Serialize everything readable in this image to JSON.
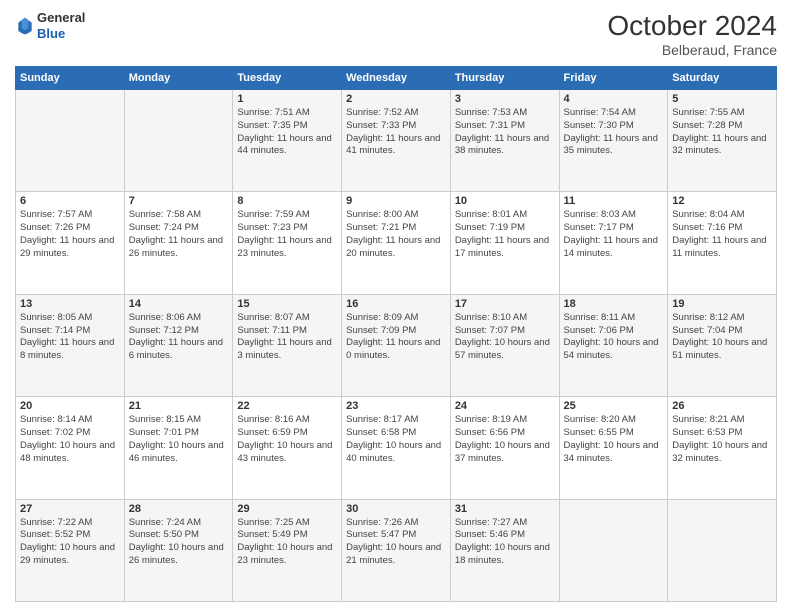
{
  "header": {
    "logo_general": "General",
    "logo_blue": "Blue",
    "month_year": "October 2024",
    "location": "Belberaud, France"
  },
  "days_of_week": [
    "Sunday",
    "Monday",
    "Tuesday",
    "Wednesday",
    "Thursday",
    "Friday",
    "Saturday"
  ],
  "weeks": [
    [
      {
        "day": "",
        "info": ""
      },
      {
        "day": "",
        "info": ""
      },
      {
        "day": "1",
        "info": "Sunrise: 7:51 AM\nSunset: 7:35 PM\nDaylight: 11 hours and 44 minutes."
      },
      {
        "day": "2",
        "info": "Sunrise: 7:52 AM\nSunset: 7:33 PM\nDaylight: 11 hours and 41 minutes."
      },
      {
        "day": "3",
        "info": "Sunrise: 7:53 AM\nSunset: 7:31 PM\nDaylight: 11 hours and 38 minutes."
      },
      {
        "day": "4",
        "info": "Sunrise: 7:54 AM\nSunset: 7:30 PM\nDaylight: 11 hours and 35 minutes."
      },
      {
        "day": "5",
        "info": "Sunrise: 7:55 AM\nSunset: 7:28 PM\nDaylight: 11 hours and 32 minutes."
      }
    ],
    [
      {
        "day": "6",
        "info": "Sunrise: 7:57 AM\nSunset: 7:26 PM\nDaylight: 11 hours and 29 minutes."
      },
      {
        "day": "7",
        "info": "Sunrise: 7:58 AM\nSunset: 7:24 PM\nDaylight: 11 hours and 26 minutes."
      },
      {
        "day": "8",
        "info": "Sunrise: 7:59 AM\nSunset: 7:23 PM\nDaylight: 11 hours and 23 minutes."
      },
      {
        "day": "9",
        "info": "Sunrise: 8:00 AM\nSunset: 7:21 PM\nDaylight: 11 hours and 20 minutes."
      },
      {
        "day": "10",
        "info": "Sunrise: 8:01 AM\nSunset: 7:19 PM\nDaylight: 11 hours and 17 minutes."
      },
      {
        "day": "11",
        "info": "Sunrise: 8:03 AM\nSunset: 7:17 PM\nDaylight: 11 hours and 14 minutes."
      },
      {
        "day": "12",
        "info": "Sunrise: 8:04 AM\nSunset: 7:16 PM\nDaylight: 11 hours and 11 minutes."
      }
    ],
    [
      {
        "day": "13",
        "info": "Sunrise: 8:05 AM\nSunset: 7:14 PM\nDaylight: 11 hours and 8 minutes."
      },
      {
        "day": "14",
        "info": "Sunrise: 8:06 AM\nSunset: 7:12 PM\nDaylight: 11 hours and 6 minutes."
      },
      {
        "day": "15",
        "info": "Sunrise: 8:07 AM\nSunset: 7:11 PM\nDaylight: 11 hours and 3 minutes."
      },
      {
        "day": "16",
        "info": "Sunrise: 8:09 AM\nSunset: 7:09 PM\nDaylight: 11 hours and 0 minutes."
      },
      {
        "day": "17",
        "info": "Sunrise: 8:10 AM\nSunset: 7:07 PM\nDaylight: 10 hours and 57 minutes."
      },
      {
        "day": "18",
        "info": "Sunrise: 8:11 AM\nSunset: 7:06 PM\nDaylight: 10 hours and 54 minutes."
      },
      {
        "day": "19",
        "info": "Sunrise: 8:12 AM\nSunset: 7:04 PM\nDaylight: 10 hours and 51 minutes."
      }
    ],
    [
      {
        "day": "20",
        "info": "Sunrise: 8:14 AM\nSunset: 7:02 PM\nDaylight: 10 hours and 48 minutes."
      },
      {
        "day": "21",
        "info": "Sunrise: 8:15 AM\nSunset: 7:01 PM\nDaylight: 10 hours and 46 minutes."
      },
      {
        "day": "22",
        "info": "Sunrise: 8:16 AM\nSunset: 6:59 PM\nDaylight: 10 hours and 43 minutes."
      },
      {
        "day": "23",
        "info": "Sunrise: 8:17 AM\nSunset: 6:58 PM\nDaylight: 10 hours and 40 minutes."
      },
      {
        "day": "24",
        "info": "Sunrise: 8:19 AM\nSunset: 6:56 PM\nDaylight: 10 hours and 37 minutes."
      },
      {
        "day": "25",
        "info": "Sunrise: 8:20 AM\nSunset: 6:55 PM\nDaylight: 10 hours and 34 minutes."
      },
      {
        "day": "26",
        "info": "Sunrise: 8:21 AM\nSunset: 6:53 PM\nDaylight: 10 hours and 32 minutes."
      }
    ],
    [
      {
        "day": "27",
        "info": "Sunrise: 7:22 AM\nSunset: 5:52 PM\nDaylight: 10 hours and 29 minutes."
      },
      {
        "day": "28",
        "info": "Sunrise: 7:24 AM\nSunset: 5:50 PM\nDaylight: 10 hours and 26 minutes."
      },
      {
        "day": "29",
        "info": "Sunrise: 7:25 AM\nSunset: 5:49 PM\nDaylight: 10 hours and 23 minutes."
      },
      {
        "day": "30",
        "info": "Sunrise: 7:26 AM\nSunset: 5:47 PM\nDaylight: 10 hours and 21 minutes."
      },
      {
        "day": "31",
        "info": "Sunrise: 7:27 AM\nSunset: 5:46 PM\nDaylight: 10 hours and 18 minutes."
      },
      {
        "day": "",
        "info": ""
      },
      {
        "day": "",
        "info": ""
      }
    ]
  ]
}
